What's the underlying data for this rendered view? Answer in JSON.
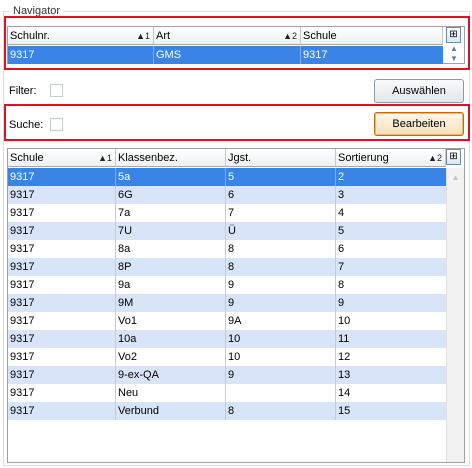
{
  "navigator": {
    "title": "Navigator",
    "columns": [
      {
        "label": "Schulnr.",
        "sort": "▲1"
      },
      {
        "label": "Art",
        "sort": "▲2"
      },
      {
        "label": "Schule",
        "sort": ""
      }
    ],
    "rows": [
      {
        "schulnr": "9317",
        "art": "GMS",
        "schule": "9317"
      }
    ],
    "column_picker_icon": "column-chooser-icon"
  },
  "filter": {
    "label": "Filter:",
    "checked": false
  },
  "suche": {
    "label": "Suche:",
    "checked": false
  },
  "buttons": {
    "auswaehlen": "Auswählen",
    "bearbeiten": "Bearbeiten"
  },
  "classes": {
    "columns": [
      {
        "label": "Schule",
        "sort": "▲1"
      },
      {
        "label": "Klassenbez.",
        "sort": ""
      },
      {
        "label": "Jgst.",
        "sort": ""
      },
      {
        "label": "Sortierung",
        "sort": "▲2"
      }
    ],
    "rows": [
      {
        "schule": "9317",
        "klasse": "5a",
        "jgst": "5",
        "sort": "2"
      },
      {
        "schule": "9317",
        "klasse": "6G",
        "jgst": "6",
        "sort": "3"
      },
      {
        "schule": "9317",
        "klasse": "7a",
        "jgst": "7",
        "sort": "4"
      },
      {
        "schule": "9317",
        "klasse": "7U",
        "jgst": "Ü",
        "sort": "5"
      },
      {
        "schule": "9317",
        "klasse": "8a",
        "jgst": "8",
        "sort": "6"
      },
      {
        "schule": "9317",
        "klasse": "8P",
        "jgst": "8",
        "sort": "7"
      },
      {
        "schule": "9317",
        "klasse": "9a",
        "jgst": "9",
        "sort": "8"
      },
      {
        "schule": "9317",
        "klasse": "9M",
        "jgst": "9",
        "sort": "9"
      },
      {
        "schule": "9317",
        "klasse": "Vo1",
        "jgst": "9A",
        "sort": "10"
      },
      {
        "schule": "9317",
        "klasse": "10a",
        "jgst": "10",
        "sort": "11"
      },
      {
        "schule": "9317",
        "klasse": "Vo2",
        "jgst": "10",
        "sort": "12"
      },
      {
        "schule": "9317",
        "klasse": "9-ex-QA",
        "jgst": "9",
        "sort": "13"
      },
      {
        "schule": "9317",
        "klasse": "Neu",
        "jgst": "",
        "sort": "14"
      },
      {
        "schule": "9317",
        "klasse": "Verbund",
        "jgst": "8",
        "sort": "15"
      }
    ],
    "selected_index": 0
  },
  "colors": {
    "selected_row": "#3a84e6",
    "alt_row": "#d8e4f7",
    "highlight_frame": "#e01020"
  }
}
